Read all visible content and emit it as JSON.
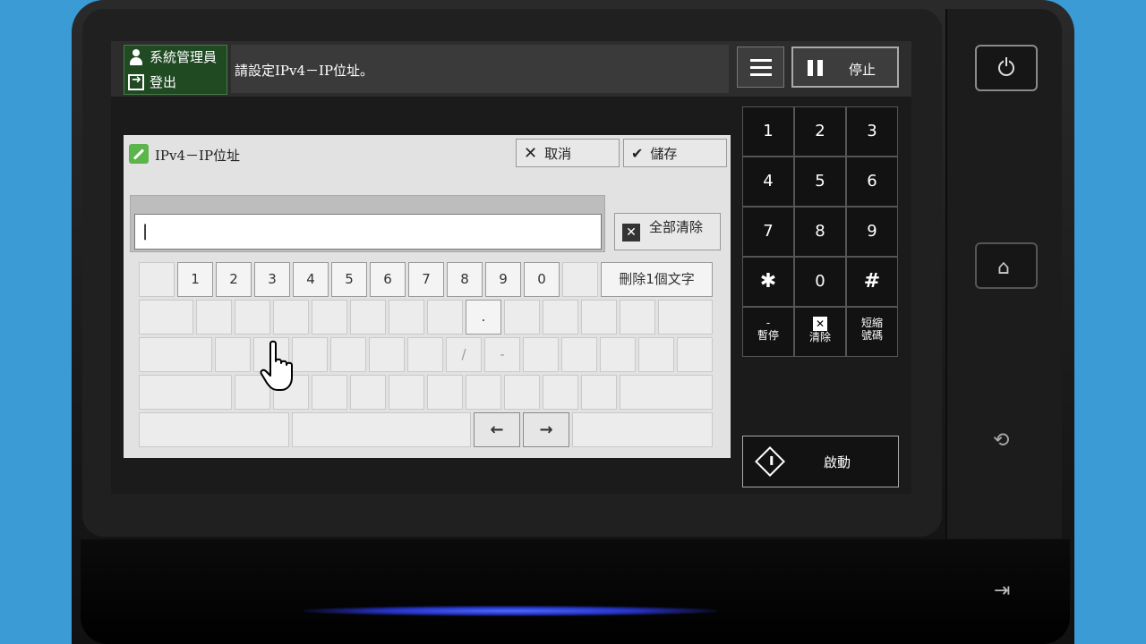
{
  "header": {
    "admin_label": "系統管理員",
    "logout_label": "登出",
    "message": "請設定IPv4－IP位址。",
    "stop_label": "停止"
  },
  "dialog": {
    "title": "IPv4－IP位址",
    "cancel_label": "取消",
    "save_label": "儲存",
    "input_value": "",
    "clear_all_label": "全部清除"
  },
  "keyboard": {
    "digits": [
      "1",
      "2",
      "3",
      "4",
      "5",
      "6",
      "7",
      "8",
      "9",
      "0"
    ],
    "delete_label": "刪除1個文字",
    "dot": ".",
    "slash": "/",
    "dash": "-",
    "left_arrow": "←",
    "right_arrow": "→"
  },
  "keypad": {
    "keys": [
      "1",
      "2",
      "3",
      "4",
      "5",
      "6",
      "7",
      "8",
      "9",
      "✱",
      "0",
      "#"
    ],
    "pause_symbol": "-",
    "pause_label": "暫停",
    "clear_symbol": "✕",
    "clear_label": "清除",
    "speed_dial_line1": "短縮",
    "speed_dial_line2": "號碼",
    "start_label": "啟動"
  },
  "icons": {
    "power": "power-icon",
    "home": "home-icon",
    "nfc": "nfc-icon",
    "data": "data-arrow-icon"
  }
}
